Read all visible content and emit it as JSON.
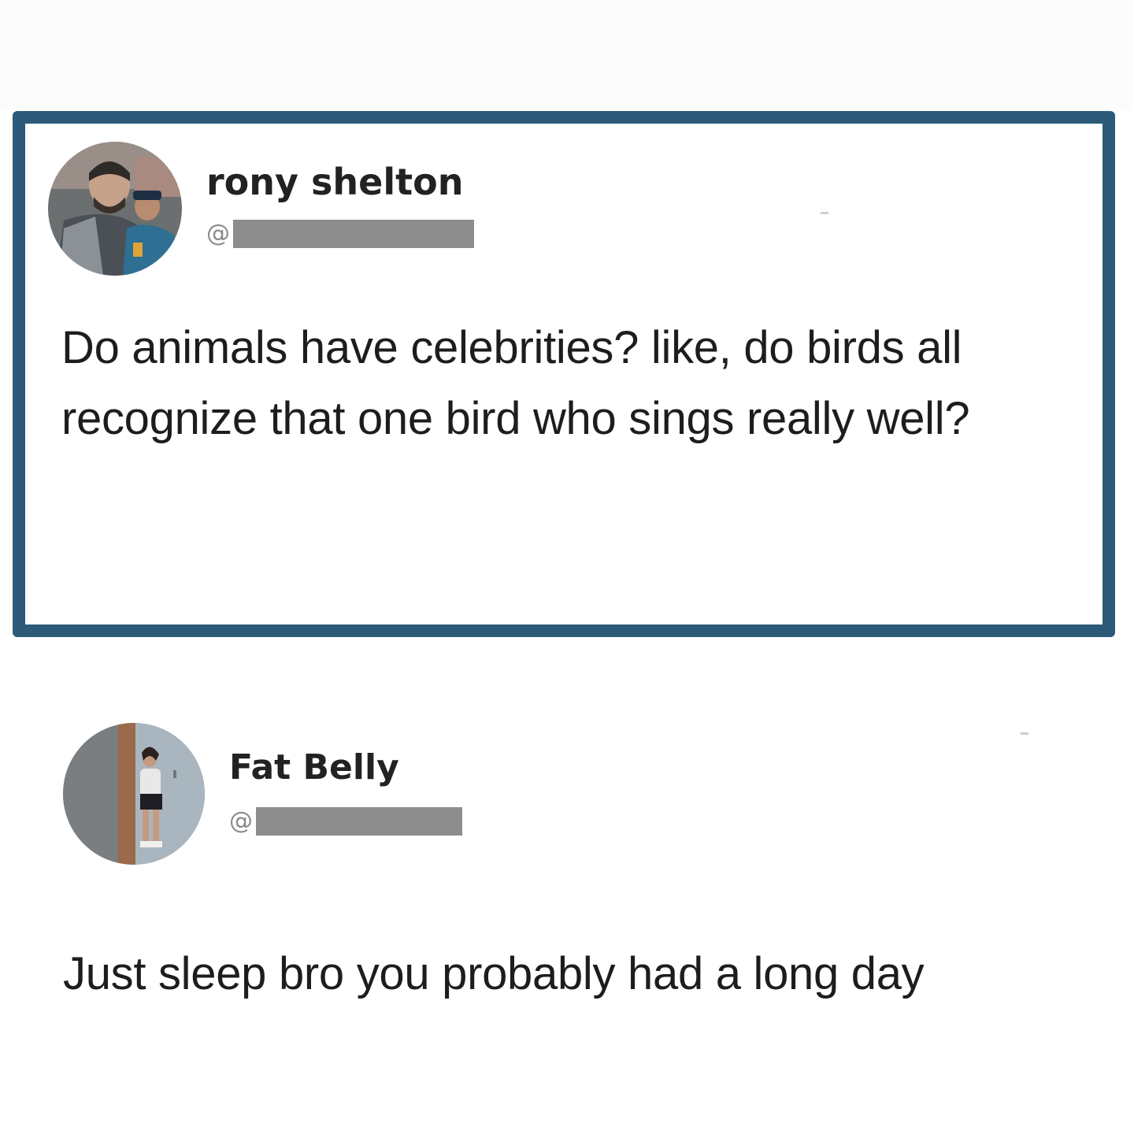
{
  "posts": [
    {
      "display_name": "rony shelton",
      "handle_prefix": "@",
      "text": "Do animals have celebrities? like, do birds all recognize that one bird who sings really well?"
    },
    {
      "display_name": "Fat Belly",
      "handle_prefix": "@",
      "text": "Just sleep bro you probably had a long day"
    }
  ],
  "colors": {
    "frame_border": "#2c5a78",
    "redaction": "#8d8d8d"
  },
  "icons": [
    "avatar-photo",
    "avatar-photo"
  ]
}
